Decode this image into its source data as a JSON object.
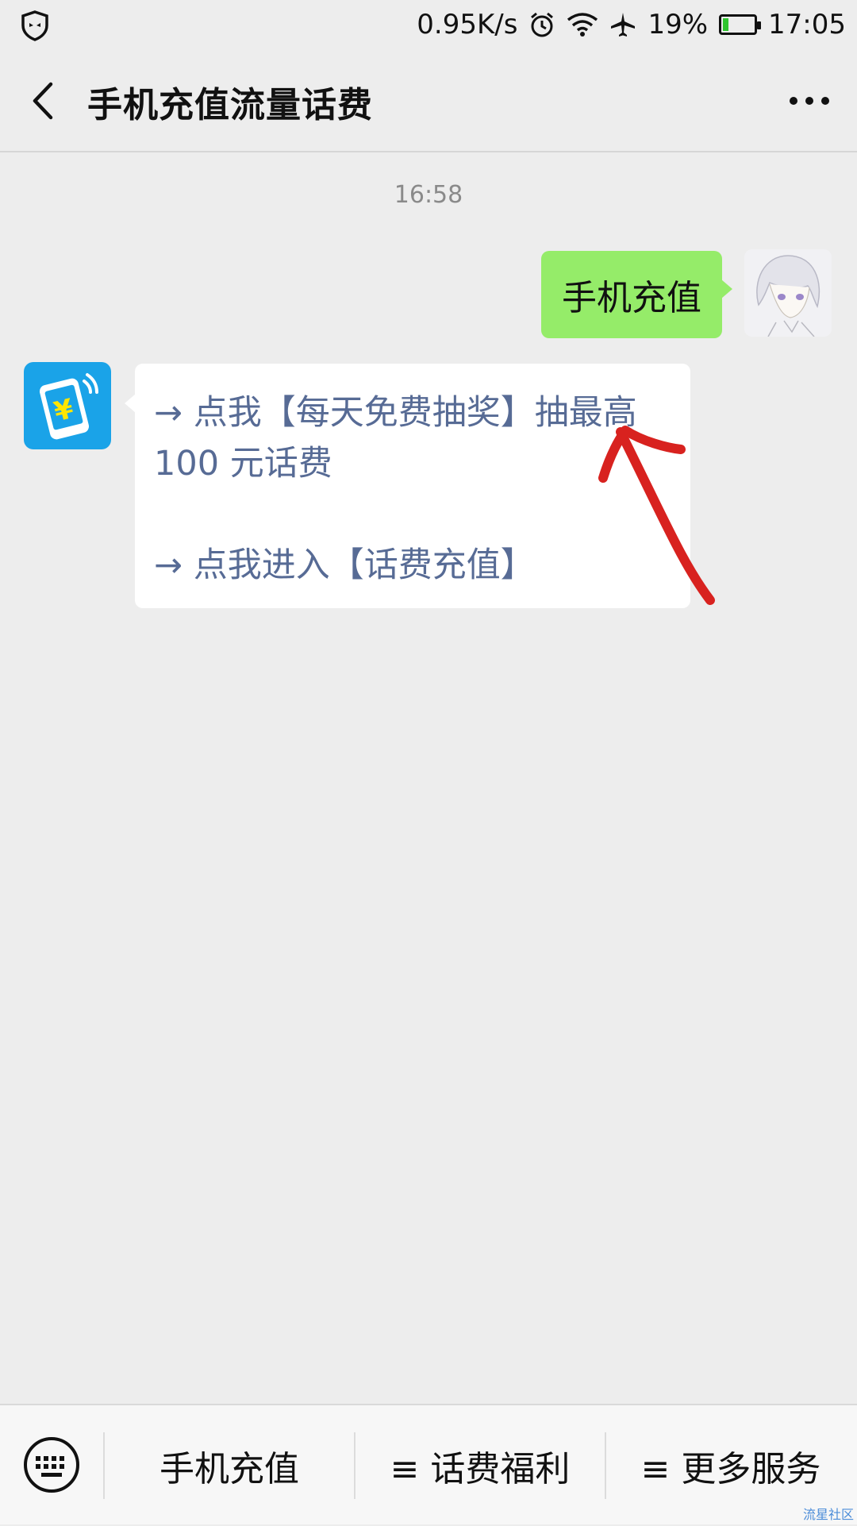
{
  "status_bar": {
    "network_speed": "0.95K/s",
    "battery_percent": "19%",
    "battery_level": 0.19,
    "time": "17:05",
    "icons": [
      "shield-icon",
      "alarm-icon",
      "wifi-icon",
      "airplane-mode-icon",
      "battery-icon"
    ]
  },
  "header": {
    "title": "手机充值流量话费",
    "back_icon": "chevron-left-icon",
    "more_icon": "more-dots-icon"
  },
  "chat": {
    "timestamp": "16:58",
    "sent_message": "手机充值",
    "received_links": [
      "→ 点我【每天免费抽奖】抽最高",
      "100 元话费",
      "→ 点我进入【话费充值】"
    ],
    "link_color": "#576b95",
    "sent_bubble_color": "#95ec69"
  },
  "bottom_menu": {
    "keyboard_icon": "keyboard-icon",
    "items": [
      "手机充值",
      "≡ 话费福利",
      "≡ 更多服务"
    ]
  },
  "watermark": "流星社区"
}
